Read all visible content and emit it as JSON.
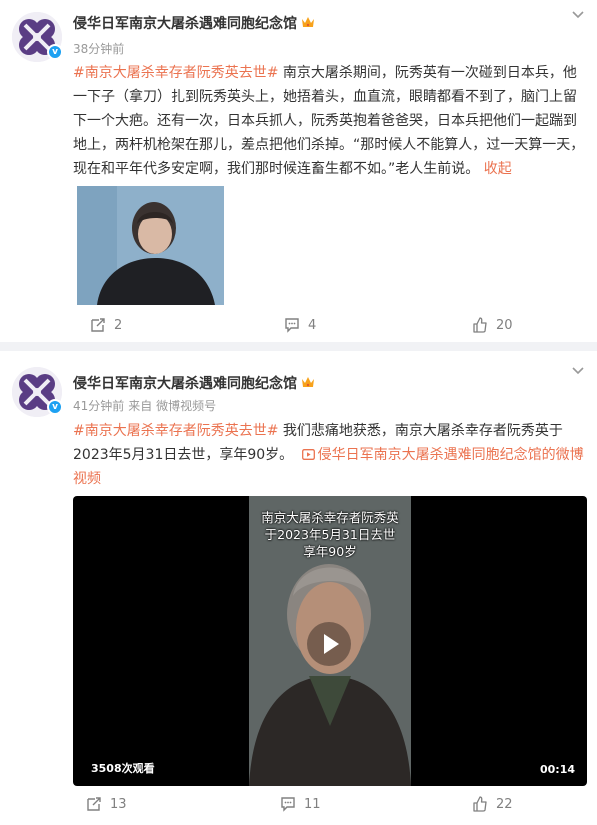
{
  "posts": [
    {
      "author": "侵华日军南京大屠杀遇难同胞纪念馆",
      "time": "38分钟前",
      "source": "",
      "hashtag": "#南京大屠杀幸存者阮秀英去世#",
      "body": " 南京大屠杀期间，阮秀英有一次碰到日本兵，他一下子（拿刀）扎到阮秀英头上，她捂着头，血直流，眼睛都看不到了，脑门上留下一个大疤。还有一次，日本兵抓人，阮秀英抱着爸爸哭，日本兵把他们一起踹到地上，两杆机枪架在那儿，差点把他们杀掉。“那时候人不能算人，过一天算一天，现在和平年代多安定啊，我们那时候连畜生都不如。”老人生前说。",
      "collapse_label": "收起",
      "reposts": "2",
      "comments": "4",
      "likes": "20"
    },
    {
      "author": "侵华日军南京大屠杀遇难同胞纪念馆",
      "time": "41分钟前",
      "source": "来自 微博视频号",
      "hashtag": "#南京大屠杀幸存者阮秀英去世#",
      "body": " 我们悲痛地获悉，南京大屠杀幸存者阮秀英于2023年5月31日去世，享年90岁。",
      "video_link": "侵华日军南京大屠杀遇难同胞纪念馆的微博视频",
      "video_caption": [
        "南京大屠杀幸存者阮秀英",
        "于2023年5月31日去世",
        "享年90岁"
      ],
      "video_views": "3508次观看",
      "video_duration": "00:14",
      "reposts": "13",
      "comments": "11",
      "likes": "22"
    }
  ],
  "icons": {
    "repost": "repost-icon",
    "comment": "comment-icon",
    "like": "thumbs-up-icon",
    "more": "chevron-down-icon",
    "crown": "crown-icon",
    "verified": "verified-icon",
    "video": "video-link-icon"
  },
  "colors": {
    "hashtag": "#eb7350",
    "badge": "#1da1f2",
    "meta": "#999999"
  }
}
